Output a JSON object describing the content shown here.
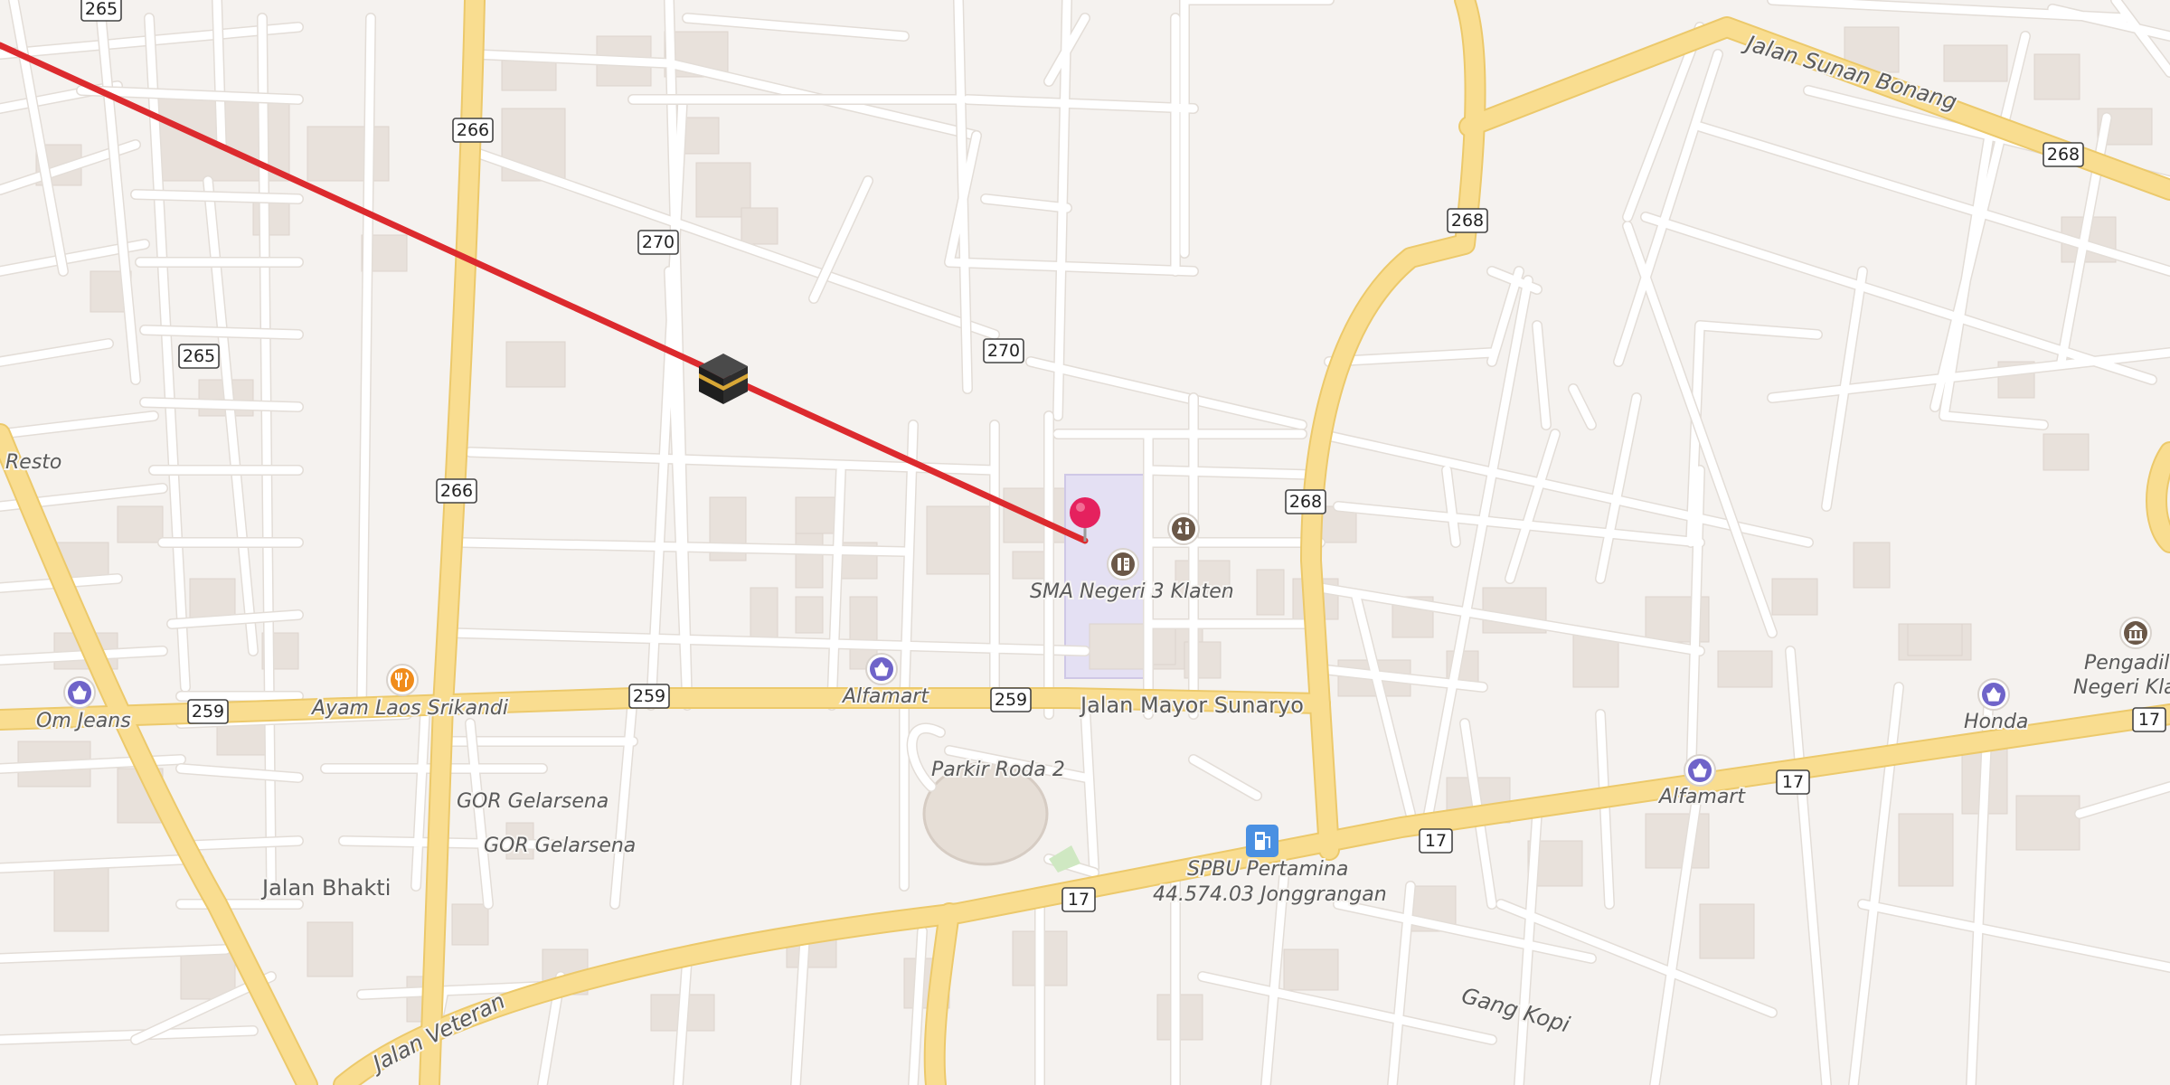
{
  "map": {
    "route_color": "#dc2a2e",
    "pin_color": "#e5215e",
    "major_road_color": "#f9dd90",
    "minor_road_color": "#ffffff",
    "background_color": "#f5f2ef",
    "school_area_color": "#e4e0f3"
  },
  "road_labels": {
    "jalan_sunan_bonang": "Jalan Sunan Bonang",
    "jalan_mayor_sunaryo": "Jalan Mayor Sunaryo",
    "jalan_bhakti": "Jalan Bhakti",
    "jalan_veteran": "Jalan Veteran",
    "gang_kopi": "Gang Kopi",
    "parkir_roda_2": "Parkir Roda 2"
  },
  "place_labels": {
    "resto": "Resto",
    "om_jeans": "Om Jeans",
    "ayam_laos": "Ayam Laos Srikandi",
    "alfamart_1": "Alfamart",
    "alfamart_2": "Alfamart",
    "gor_1": "GOR Gelarsena",
    "gor_2": "GOR Gelarsena",
    "sma": "SMA Negeri 3 Klaten",
    "spbu_line1": "SPBU Pertamina",
    "spbu_line2": "44.574.03 Jonggrangan",
    "honda": "Honda",
    "pengadilan_line1": "Pengadila",
    "pengadilan_line2": "Negeri Kla"
  },
  "shields": {
    "s265a": "265",
    "s265b": "265",
    "s266a": "266",
    "s266b": "266",
    "s270a": "270",
    "s270b": "270",
    "s268a": "268",
    "s268b": "268",
    "s268c": "268",
    "s259a": "259",
    "s259b": "259",
    "s259c": "259",
    "s17a": "17",
    "s17b": "17",
    "s17c": "17",
    "s17d": "17"
  },
  "icons": {
    "kaaba": "kaaba-icon",
    "pin": "location-pin-icon",
    "school": "school-icon",
    "toilets": "toilets-icon",
    "shop": "shopping-basket-icon",
    "restaurant": "fork-knife-icon",
    "fuel": "fuel-pump-icon",
    "courthouse": "courthouse-icon"
  }
}
